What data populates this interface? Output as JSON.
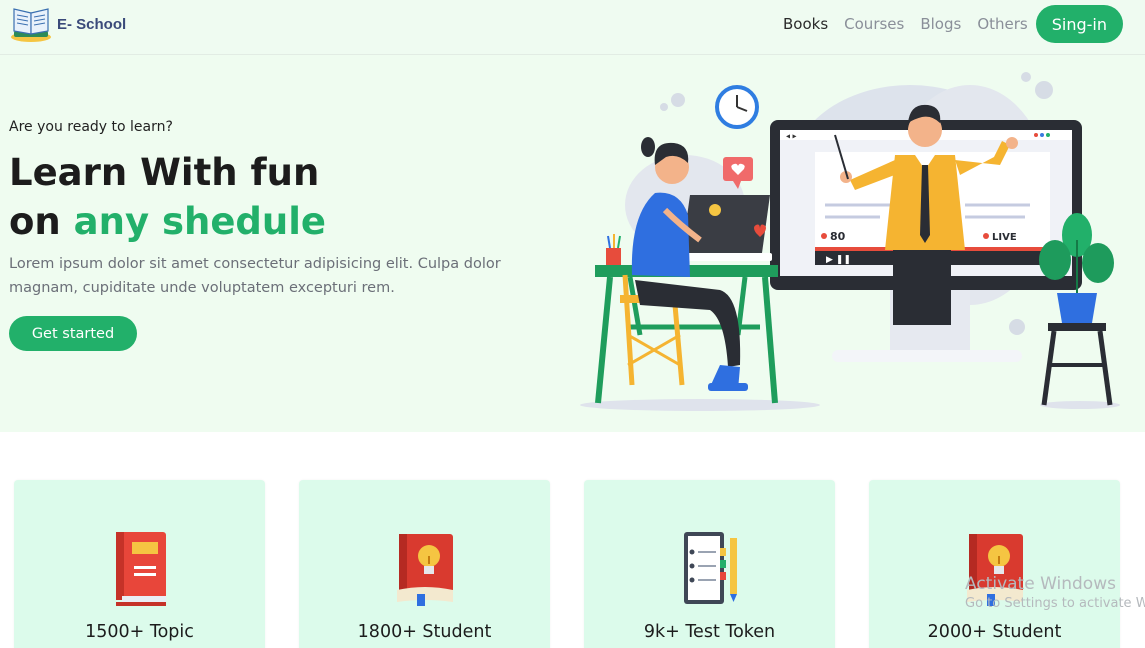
{
  "brand": {
    "name": "E- School",
    "logo_icon": "open-book-icon"
  },
  "nav": {
    "links": [
      {
        "label": "Books",
        "active": true
      },
      {
        "label": "Courses",
        "active": false
      },
      {
        "label": "Blogs",
        "active": false
      },
      {
        "label": "Others",
        "active": false
      }
    ],
    "signin_label": "Sing-in"
  },
  "hero": {
    "kicker": "Are you ready to learn?",
    "title_line1": "Learn With fun",
    "title_line2_prefix": "on ",
    "title_line2_accent": "any shedule",
    "description": "Lorem ipsum dolor sit amet consectetur adipisicing elit. Culpa dolor magnam, cupiditate unde voluptatem excepturi rem.",
    "cta_label": "Get started",
    "illustration": {
      "viewer_count": "80",
      "live_label": "LIVE"
    }
  },
  "stats": [
    {
      "label": "1500+ Topic",
      "icon": "closed-book-icon"
    },
    {
      "label": "1800+ Student",
      "icon": "idea-book-icon"
    },
    {
      "label": "9k+ Test Token",
      "icon": "notebook-pencil-icon"
    },
    {
      "label": "2000+ Student",
      "icon": "idea-book-icon"
    }
  ],
  "watermark": {
    "title": "Activate Windows",
    "subtitle": "Go to Settings to activate Windows."
  },
  "colors": {
    "accent": "#22b06a",
    "hero_bg": "#effcf0",
    "nav_bg": "#effbf1",
    "card_bg": "#dcfbeb"
  }
}
